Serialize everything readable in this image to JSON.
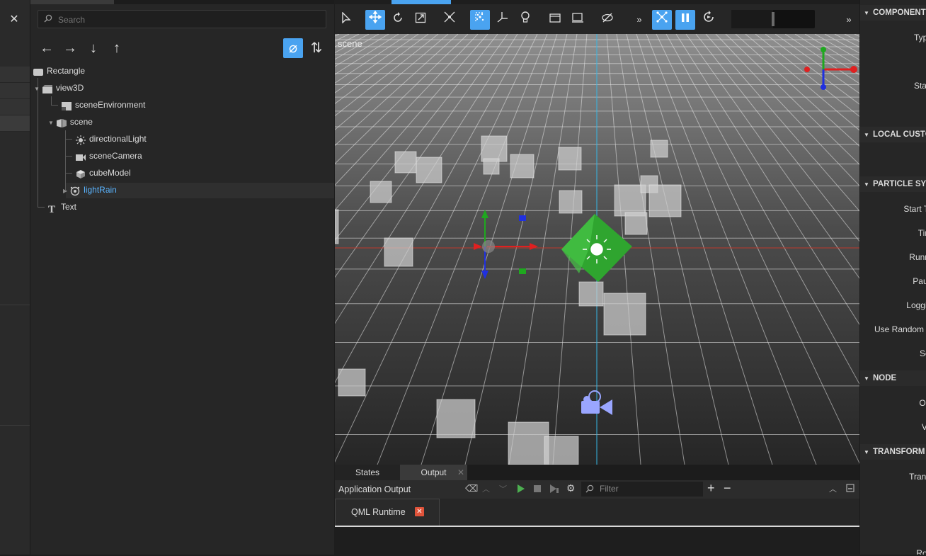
{
  "left_strip": {
    "close_label": "✕"
  },
  "navigator": {
    "search_placeholder": "Search",
    "buttons": [
      "←",
      "→",
      "↓",
      "↑"
    ],
    "filter_icon": "⌀",
    "sort_icon": "⇅",
    "tree": [
      {
        "label": "Rectangle",
        "icon": "rectangle-icon",
        "selected": false
      },
      {
        "label": "view3D",
        "icon": "view3d-icon",
        "selected": false
      },
      {
        "label": "sceneEnvironment",
        "icon": "scene-environment-icon",
        "selected": false
      },
      {
        "label": "scene",
        "icon": "scene-node-icon",
        "selected": false
      },
      {
        "label": "directionalLight",
        "icon": "light-icon",
        "selected": false
      },
      {
        "label": "sceneCamera",
        "icon": "camera-icon",
        "selected": false
      },
      {
        "label": "cubeModel",
        "icon": "model-icon",
        "selected": false
      },
      {
        "label": "lightRain",
        "icon": "particle-system-icon",
        "selected": true
      },
      {
        "label": "Text",
        "icon": "text-icon",
        "selected": false
      }
    ]
  },
  "viewport": {
    "scene_label": "scene",
    "more_glyph": "»",
    "slider_value": 0.5
  },
  "output_panel": {
    "tabs": [
      "States",
      "Output"
    ],
    "title": "Application Output",
    "filter_placeholder": "Filter",
    "plus": "+",
    "minus": "−",
    "runtime_tab": "QML Runtime"
  },
  "properties": {
    "sections": [
      {
        "label": "COMPONENT"
      },
      {
        "label": "LOCAL CUSTOM"
      },
      {
        "label": "PARTICLE SYSTEM"
      },
      {
        "label": "NODE"
      },
      {
        "label": "TRANSFORM"
      }
    ],
    "labels": {
      "type": "Type",
      "state": "State",
      "start_time": "Start Time",
      "time": "Time",
      "running": "Running",
      "paused": "Paused",
      "logging": "Logging",
      "use_random_seed": "Use Random Seed",
      "seed": "Seed",
      "opacity": "Opacity",
      "visibility": "Visibility",
      "translation": "Translation",
      "rotation": "Rotation"
    }
  },
  "colors": {
    "accent": "#4aa3f0",
    "selected_text": "#5ab4ff",
    "close_red": "#e0533a"
  }
}
